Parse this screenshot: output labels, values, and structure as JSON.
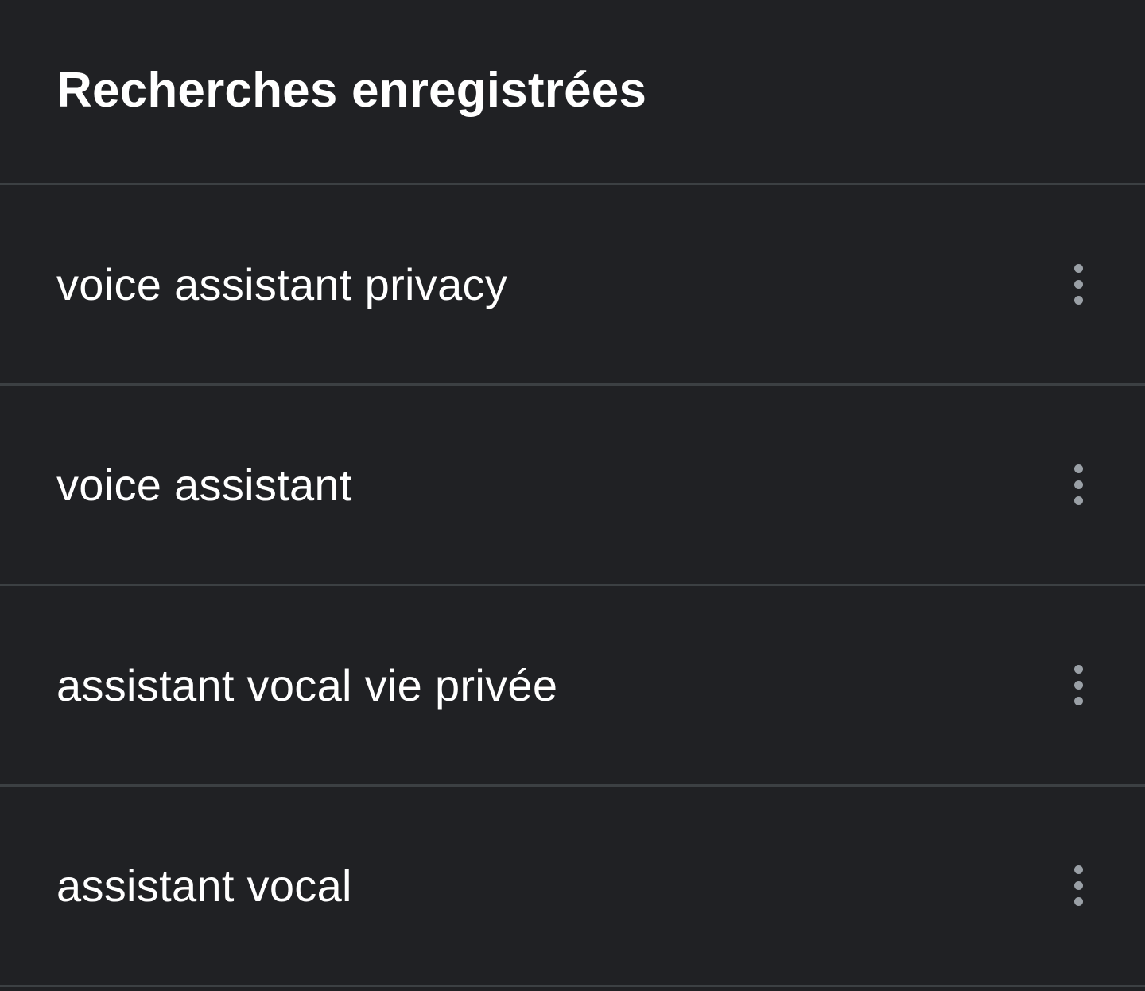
{
  "header": {
    "title": "Recherches enregistrées"
  },
  "saved_searches": [
    {
      "label": "voice assistant privacy",
      "menu_icon": "more-vert-icon"
    },
    {
      "label": "voice assistant",
      "menu_icon": "more-vert-icon"
    },
    {
      "label": "assistant vocal vie privée",
      "menu_icon": "more-vert-icon"
    },
    {
      "label": "assistant vocal",
      "menu_icon": "more-vert-icon"
    }
  ],
  "colors": {
    "background": "#202124",
    "divider": "#3c4043",
    "text": "#ffffff",
    "icon": "#9aa0a6"
  }
}
